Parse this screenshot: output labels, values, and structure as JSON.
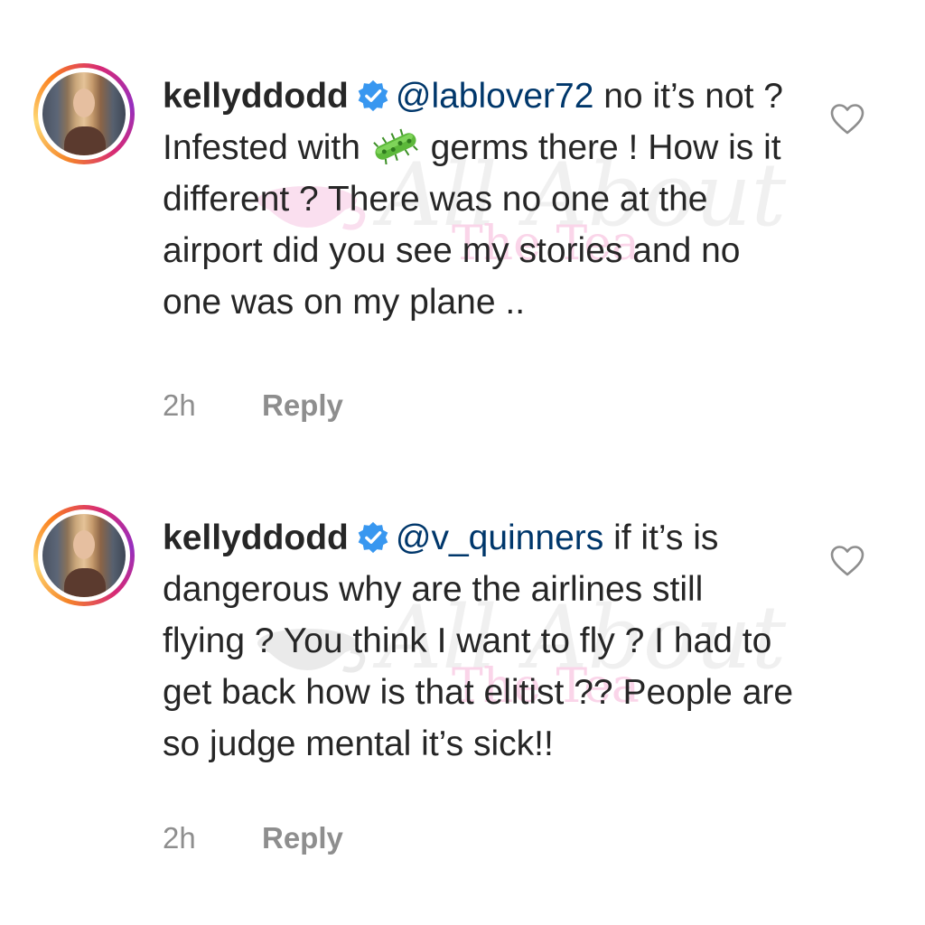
{
  "comments": [
    {
      "username": "kellyddodd",
      "mention": "@lablover72",
      "text_before_icon": " no it’s not ?  Infested with ",
      "text_after_icon": " germs there !  How is it different ? There was no one at the airport did you see my stories and no one was on my plane ..",
      "time": "2h",
      "reply_label": "Reply"
    },
    {
      "username": "kellyddodd",
      "mention": "@v_quinners",
      "text": " if it’s is dangerous why are the airlines still flying ?  You think I want to fly ?  I had to get back how is that elitist ?? People are so judge mental it’s sick!!",
      "time": "2h",
      "reply_label": "Reply"
    }
  ],
  "watermark": {
    "script": "All About",
    "sub": "The Tea"
  },
  "icons": {
    "verified": "verified-badge-icon",
    "heart": "heart-outline-icon",
    "germ": "microbe-emoji-icon"
  },
  "colors": {
    "text": "#262626",
    "mention": "#00376b",
    "meta": "#8e8e8e",
    "verified": "#3897f0",
    "watermark_pink": "#f7b3d8"
  }
}
